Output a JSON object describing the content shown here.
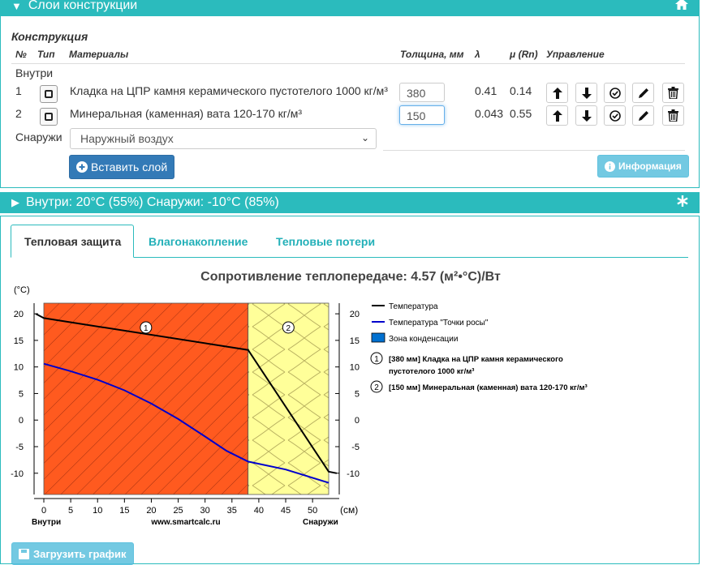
{
  "layers_panel": {
    "header_title": "Слои конструкции",
    "section_title": "Конструкция",
    "columns": {
      "num": "№",
      "type": "Тип",
      "materials": "Материалы",
      "thickness": "Толщина, мм",
      "lambda": "λ",
      "mu": "μ (Rn)",
      "control": "Управление"
    },
    "inside_label": "Внутри",
    "rows": [
      {
        "num": "1",
        "material": "Кладка на ЦПР камня керамического пустотелого 1000 кг/м³",
        "thickness": "380",
        "lambda": "0.41",
        "mu": "0.14"
      },
      {
        "num": "2",
        "material": "Минеральная (каменная) вата 120-170 кг/м³",
        "thickness": "150",
        "lambda": "0.043",
        "mu": "0.55"
      }
    ],
    "outside_label": "Снаружи",
    "outside_select": "Наружный воздух",
    "insert_button": "Вставить слой",
    "info_button": "Информация"
  },
  "conditions_panel": {
    "header_title": "Внутри: 20°C (55%) Снаружи: -10°C (85%)"
  },
  "tabs": [
    "Тепловая защита",
    "Влагонакопление",
    "Тепловые потери"
  ],
  "chart_title": "Сопротивление теплопередаче: 4.57 (м²•°C)/Вт",
  "download_button": "Загрузить график",
  "colors": {
    "accent": "#2bbbbd",
    "layer1": "#ff5a1f",
    "layer2": "#ffff99",
    "temperature": "#000000",
    "dew": "#0000cc",
    "condensation": "#0070d0"
  },
  "chart_data": {
    "type": "line",
    "ylabel": "(°C)",
    "xlabel_unit": "(см)",
    "x_left_label": "Внутри",
    "x_center_label": "www.smartcalc.ru",
    "x_right_label": "Снаружи",
    "xlim": [
      0,
      53
    ],
    "ylim": [
      -14,
      22
    ],
    "x_ticks": [
      0,
      5,
      10,
      15,
      20,
      25,
      30,
      35,
      40,
      45,
      50
    ],
    "y_ticks": [
      20,
      15,
      10,
      5,
      0,
      -5,
      -10
    ],
    "layers": [
      {
        "marker": "1",
        "from": 0,
        "to": 38
      },
      {
        "marker": "2",
        "from": 38,
        "to": 53
      }
    ],
    "series": [
      {
        "name": "Температура",
        "x": [
          -1.5,
          0,
          38,
          53,
          54.5
        ],
        "y": [
          20,
          19.2,
          13.2,
          -9.7,
          -10
        ]
      },
      {
        "name": "Температура \"Точки росы\"",
        "x": [
          0,
          5,
          10,
          15,
          20,
          25,
          30,
          34,
          38,
          45,
          53
        ],
        "y": [
          10.6,
          9.2,
          7.6,
          5.6,
          3.1,
          0.2,
          -3.1,
          -5.8,
          -7.8,
          -9.3,
          -11.8
        ]
      }
    ],
    "legend": [
      {
        "key": "temperature",
        "label": "Температура"
      },
      {
        "key": "dew",
        "label": "Температура \"Точки росы\""
      },
      {
        "key": "condensation",
        "label": "Зона конденсации"
      }
    ],
    "layer_legend": [
      {
        "num": "1",
        "text": "[380 мм] Кладка на ЦПР камня керамического пустотелого 1000 кг/м³"
      },
      {
        "num": "2",
        "text": "[150 мм] Минеральная (каменная) вата 120-170 кг/м³"
      }
    ]
  }
}
